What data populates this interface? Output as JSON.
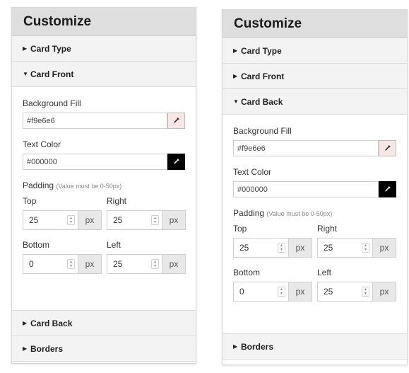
{
  "left_panel": {
    "title": "Customize",
    "sections": {
      "card_type": "Card Type",
      "card_front": "Card Front",
      "card_back": "Card Back",
      "borders": "Borders"
    },
    "expanded": "card_front",
    "fields": {
      "bg_label": "Background Fill",
      "bg_value": "#f9e6e6",
      "bg_swatch": "#f9e6e6",
      "text_label": "Text Color",
      "text_value": "#000000",
      "text_swatch": "#000000",
      "padding_label": "Padding",
      "padding_note": "(Value must be 0-50px)",
      "top_label": "Top",
      "top_value": "25",
      "right_label": "Right",
      "right_value": "25",
      "bottom_label": "Bottom",
      "bottom_value": "0",
      "left_label": "Left",
      "left_value": "25",
      "unit": "px"
    }
  },
  "right_panel": {
    "title": "Customize",
    "sections": {
      "card_type": "Card Type",
      "card_front": "Card Front",
      "card_back": "Card Back",
      "borders": "Borders"
    },
    "expanded": "card_back",
    "fields": {
      "bg_label": "Background Fill",
      "bg_value": "#f9e6e6",
      "bg_swatch": "#f9e6e6",
      "text_label": "Text Color",
      "text_value": "#000000",
      "text_swatch": "#000000",
      "padding_label": "Padding",
      "padding_note": "(Value must be 0-50px)",
      "top_label": "Top",
      "top_value": "25",
      "right_label": "Right",
      "right_value": "25",
      "bottom_label": "Bottom",
      "bottom_value": "0",
      "left_label": "Left",
      "left_value": "25",
      "unit": "px"
    }
  },
  "icons": {
    "collapsed": "caret-right-icon",
    "expanded": "caret-down-icon",
    "picker": "eyedropper-icon"
  }
}
